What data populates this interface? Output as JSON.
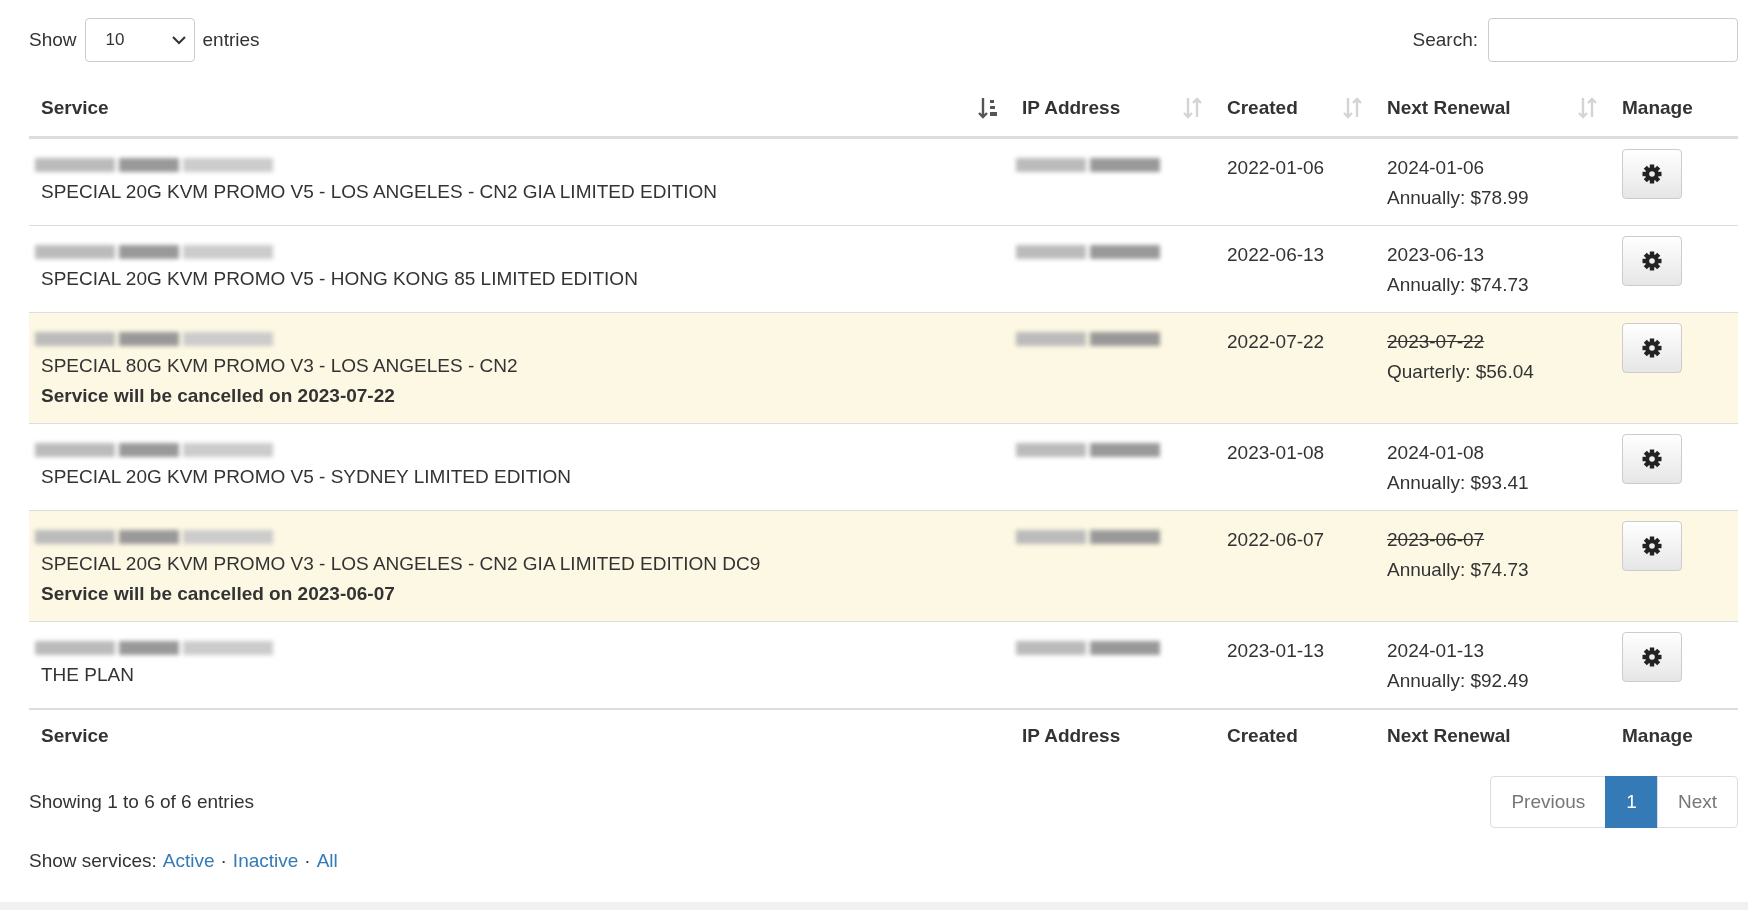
{
  "length_control": {
    "before": "Show",
    "value": "10",
    "after": "entries"
  },
  "search": {
    "label": "Search:"
  },
  "columns": [
    {
      "label": "Service",
      "sorted": true
    },
    {
      "label": "IP Address",
      "sorted": false
    },
    {
      "label": "Created",
      "sorted": false
    },
    {
      "label": "Next Renewal",
      "sorted": false
    },
    {
      "label": "Manage"
    }
  ],
  "rows": [
    {
      "product": "SPECIAL 20G KVM PROMO V5 - LOS ANGELES - CN2 GIA LIMITED EDITION",
      "cancelled": false,
      "created": "2022-01-06",
      "renewal": "2024-01-06",
      "billing": "Annually: $78.99"
    },
    {
      "product": "SPECIAL 20G KVM PROMO V5 - HONG KONG 85 LIMITED EDITION",
      "cancelled": false,
      "created": "2022-06-13",
      "renewal": "2023-06-13",
      "billing": "Annually: $74.73"
    },
    {
      "product": "SPECIAL 80G KVM PROMO V3 - LOS ANGELES - CN2",
      "cancelled": true,
      "note": "Service will be cancelled on 2023-07-22",
      "created": "2022-07-22",
      "renewal": "2023-07-22",
      "billing": "Quarterly: $56.04"
    },
    {
      "product": "SPECIAL 20G KVM PROMO V5 - SYDNEY LIMITED EDITION",
      "cancelled": false,
      "created": "2023-01-08",
      "renewal": "2024-01-08",
      "billing": "Annually: $93.41"
    },
    {
      "product": "SPECIAL 20G KVM PROMO V3 - LOS ANGELES - CN2 GIA LIMITED EDITION DC9",
      "cancelled": true,
      "note": "Service will be cancelled on 2023-06-07",
      "created": "2022-06-07",
      "renewal": "2023-06-07",
      "billing": "Annually: $74.73"
    },
    {
      "product": "THE PLAN",
      "cancelled": false,
      "created": "2023-01-13",
      "renewal": "2024-01-13",
      "billing": "Annually: $92.49"
    }
  ],
  "footer_columns": [
    "Service",
    "IP Address",
    "Created",
    "Next Renewal",
    "Manage"
  ],
  "info": "Showing 1 to 6 of 6 entries",
  "pagination": [
    {
      "label": "Previous",
      "selected": false
    },
    {
      "label": "1",
      "selected": true
    },
    {
      "label": "Next",
      "selected": false
    }
  ],
  "filter": {
    "label": "Show services:",
    "separator": "·",
    "links": [
      "Active",
      "Inactive",
      "All"
    ]
  }
}
